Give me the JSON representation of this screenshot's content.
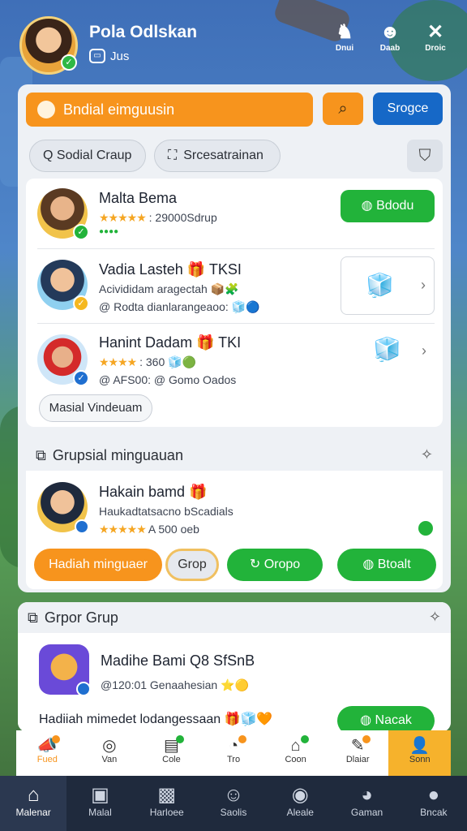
{
  "header": {
    "user_name": "Pola Odlskan",
    "user_sub": "Jus",
    "icons": [
      {
        "glyph": "♞",
        "label": "Dnui",
        "icon": "game-icon"
      },
      {
        "glyph": "☻",
        "label": "Daab",
        "icon": "friends-icon"
      },
      {
        "glyph": "✕",
        "label": "Droic",
        "icon": "tools-icon"
      }
    ]
  },
  "search": {
    "placeholder": "Bndial eimguusin",
    "search_glyph": "⌕",
    "button": "Srogce"
  },
  "chips": [
    "Q Sodial Craup",
    "Srcesatrainan"
  ],
  "list": {
    "rows": [
      {
        "name": "Malta Bema",
        "stars": "★★★★★",
        "meta": ": 29000Sdrup",
        "extra": "●●●●",
        "action": "Bdodu"
      },
      {
        "name": "Vadia Lasteh 🎁 TKSI",
        "line2": "Acivididam aragectah 📦🧩",
        "line3": "@ Rodta dianlarangeaoo: 🧊🔵"
      },
      {
        "name": "Hanint Dadam 🎁 TKI",
        "stars": "★★★★",
        "meta": ": 360 🧊🟢",
        "line3": "@ AFS00: @ Gomo Oados"
      }
    ],
    "footer_pill": "Masial Vindeuam"
  },
  "group_section": {
    "title": "Grupsial minguauan",
    "person": "Hakain bamd 🎁",
    "desc": "Haukadtatsacno bScadials",
    "stars": "★★★★★",
    "meta": "A 500 oeb",
    "buttons": [
      "Hadiah minguaer",
      "Grop",
      "Oropo",
      "Btoalt"
    ]
  },
  "group2_section": {
    "title": "Grpor Grup",
    "person": "Madihe Bami Q8 SfSnB",
    "meta": "@120:01 Genaahesian ⭐🟡",
    "bottom_text": "Hadiiah mimedet lodangessaan 🎁🧊🧡",
    "button": "Nacak"
  },
  "subnav": [
    {
      "label": "Fued",
      "glyph": "📣",
      "dot": "#f7941d"
    },
    {
      "label": "Van",
      "glyph": "◎",
      "dot": ""
    },
    {
      "label": "Cole",
      "glyph": "▤",
      "dot": "#22b33a"
    },
    {
      "label": "Tro",
      "glyph": "◔",
      "dot": "#f7941d"
    },
    {
      "label": "Coon",
      "glyph": "⌂",
      "dot": "#22b33a"
    },
    {
      "label": "Dlaiar",
      "glyph": "✎",
      "dot": "#f7941d"
    },
    {
      "label": "Sonn",
      "glyph": "👤",
      "dot": "",
      "active": true
    }
  ],
  "mainnav": [
    {
      "label": "Malenar",
      "glyph": "⌂",
      "active": true
    },
    {
      "label": "Malal",
      "glyph": "▣"
    },
    {
      "label": "Harloee",
      "glyph": "▩"
    },
    {
      "label": "Saolis",
      "glyph": "☺"
    },
    {
      "label": "Aleale",
      "glyph": "◉"
    },
    {
      "label": "Gaman",
      "glyph": "◕"
    },
    {
      "label": "Bncak",
      "glyph": "●"
    }
  ],
  "colors": {
    "accent_orange": "#f7941d",
    "accent_green": "#22b33a",
    "accent_blue": "#1668c7",
    "nav_bg": "#1f2a3d"
  }
}
